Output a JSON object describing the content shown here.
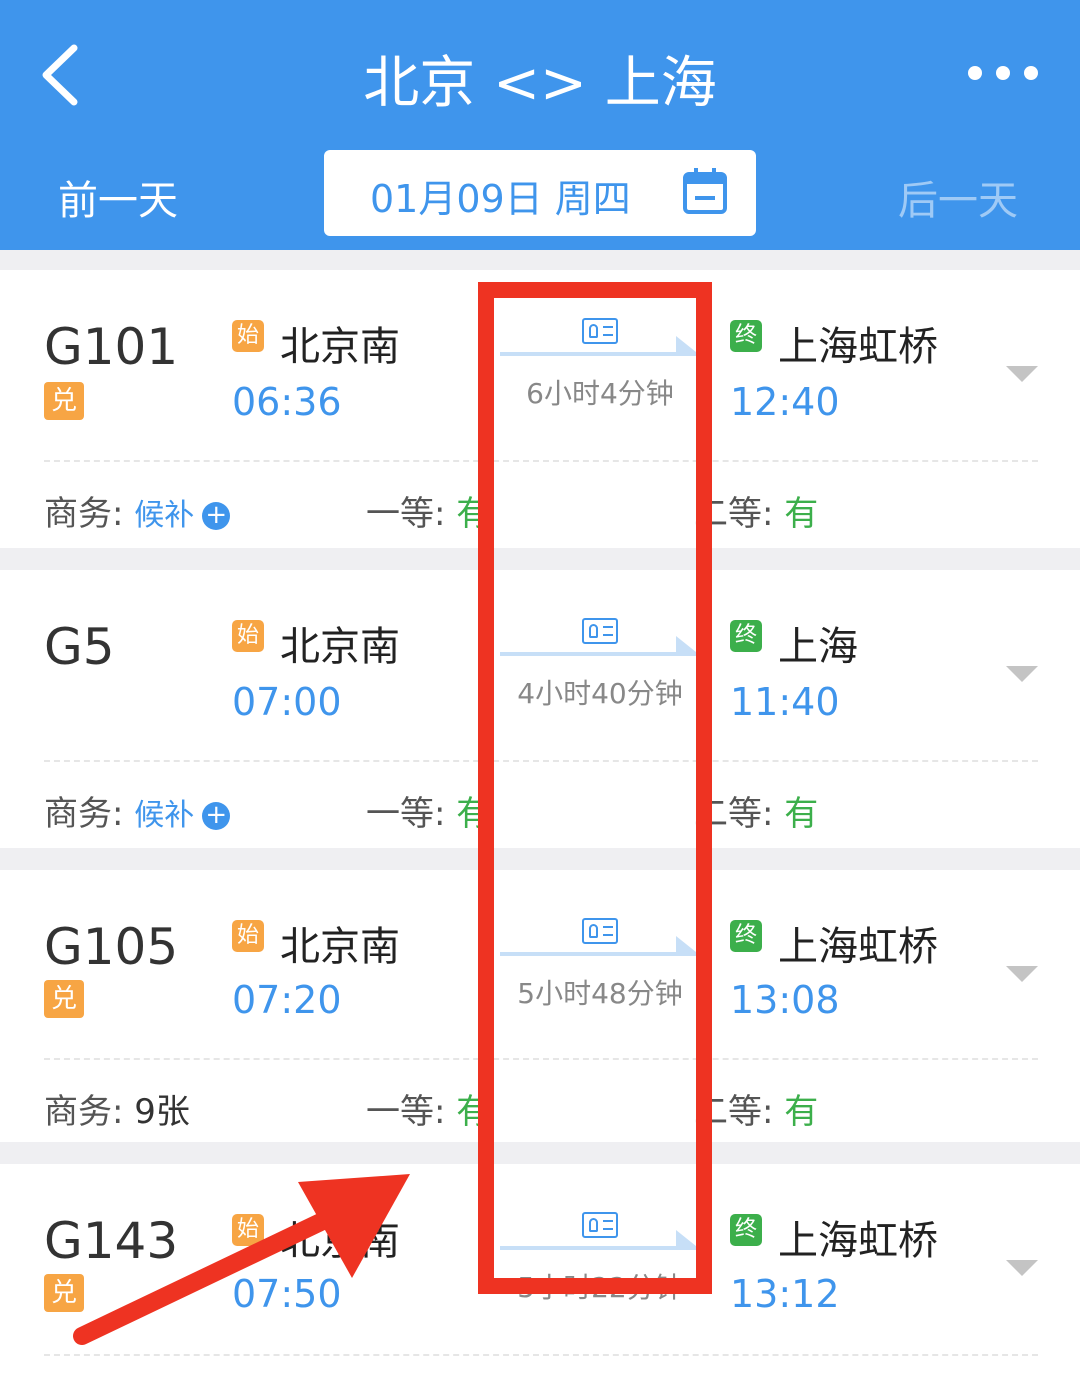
{
  "header": {
    "title": "北京 <> 上海",
    "prev_day": "前一天",
    "next_day": "后一天",
    "date": "01月09日 周四",
    "back_icon": "chevron-left-icon",
    "more_icon": "more-dots-icon",
    "calendar_icon": "calendar-icon"
  },
  "colors": {
    "primary": "#3f95ec",
    "start_tag": "#f7a544",
    "end_tag": "#3caf4b",
    "available": "#3caf4b",
    "highlight": "#ee3322"
  },
  "trains": [
    {
      "number": "G101",
      "badge": "兑",
      "start_tag": "始",
      "from": "北京南",
      "depart": "06:36",
      "end_tag": "终",
      "to": "上海虹桥",
      "arrive": "12:40",
      "duration": "6小时4分钟",
      "seats": {
        "business_label": "商务:",
        "business_value": "候补",
        "first_label": "一等:",
        "first_value": "有",
        "second_label": "二等:",
        "second_value": "有"
      }
    },
    {
      "number": "G5",
      "badge": "",
      "start_tag": "始",
      "from": "北京南",
      "depart": "07:00",
      "end_tag": "终",
      "to": "上海",
      "arrive": "11:40",
      "duration": "4小时40分钟",
      "seats": {
        "business_label": "商务:",
        "business_value": "候补",
        "first_label": "一等:",
        "first_value": "有",
        "second_label": "二等:",
        "second_value": "有"
      }
    },
    {
      "number": "G105",
      "badge": "兑",
      "start_tag": "始",
      "from": "北京南",
      "depart": "07:20",
      "end_tag": "终",
      "to": "上海虹桥",
      "arrive": "13:08",
      "duration": "5小时48分钟",
      "seats": {
        "business_label": "商务:",
        "business_value": "9张",
        "first_label": "一等:",
        "first_value": "有",
        "second_label": "二等:",
        "second_value": "有"
      }
    },
    {
      "number": "G143",
      "badge": "兑",
      "start_tag": "始",
      "from": "北京南",
      "depart": "07:50",
      "end_tag": "终",
      "to": "上海虹桥",
      "arrive": "13:12",
      "duration": "5小时22分钟"
    }
  ]
}
